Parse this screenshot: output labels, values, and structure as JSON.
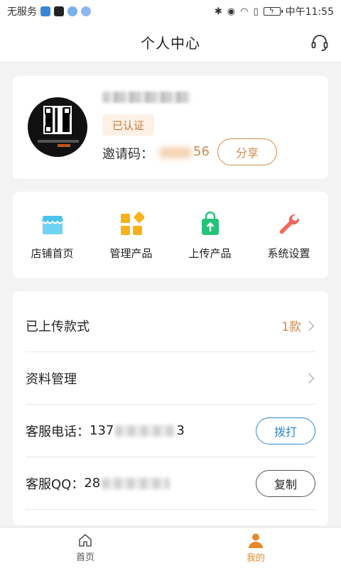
{
  "status_bar": {
    "carrier": "无服务",
    "time": "中午11:55"
  },
  "header": {
    "title": "个人中心"
  },
  "profile": {
    "verified_badge": "已认证",
    "invite_label": "邀请码：",
    "invite_code_visible": "56",
    "share_label": "分享"
  },
  "menu": {
    "items": [
      {
        "label": "店铺首页",
        "icon": "store-icon"
      },
      {
        "label": "管理产品",
        "icon": "grid-icon"
      },
      {
        "label": "上传产品",
        "icon": "upload-bag-icon"
      },
      {
        "label": "系统设置",
        "icon": "wrench-icon"
      }
    ]
  },
  "list": {
    "uploaded": {
      "label": "已上传款式",
      "count": "1款"
    },
    "profile_mgmt": {
      "label": "资料管理"
    },
    "phone": {
      "label": "客服电话：",
      "prefix": "137",
      "suffix": "3",
      "button": "拨打"
    },
    "qq": {
      "label": "客服QQ：",
      "prefix": "28",
      "button": "复制"
    }
  },
  "bottom_nav": {
    "tabs": [
      {
        "label": "首页",
        "icon": "home-icon",
        "active": false
      },
      {
        "label": "我的",
        "icon": "user-icon",
        "active": true
      }
    ],
    "active_color": "#e4892b"
  },
  "colors": {
    "accent_orange": "#d08a4a",
    "call_blue": "#2f88c9"
  }
}
